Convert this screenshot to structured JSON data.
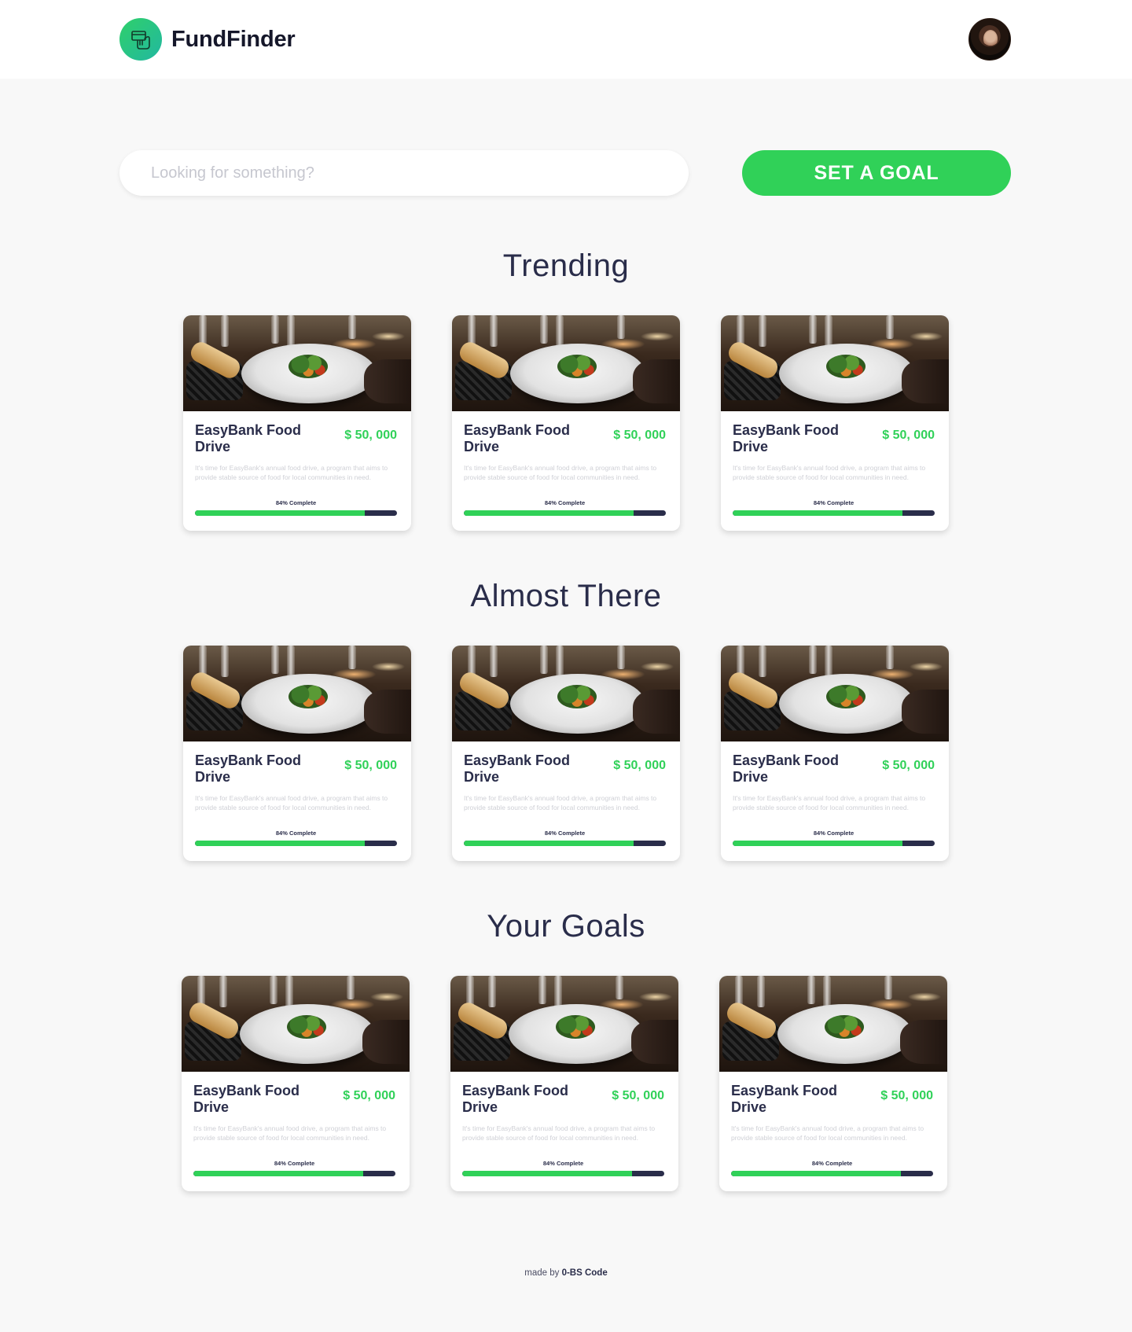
{
  "header": {
    "brand_name": "FundFinder",
    "logo_icon": "card-in-hand-icon",
    "colors": {
      "logo_gradient_start": "#2fd06a",
      "logo_gradient_end": "#22b8a0"
    }
  },
  "search": {
    "placeholder": "Looking for something?",
    "value": ""
  },
  "goal_button": {
    "label": "SET A GOAL",
    "color": "#30d158"
  },
  "sections": [
    {
      "title": "Trending",
      "cards": [
        {
          "title": "EasyBank Food Drive",
          "amount": "$ 50, 000",
          "description": "It's time for EasyBank's annual food drive, a program that aims to provide stable source of food for local communities in need.",
          "progress_label": "84% Complete",
          "progress": 0.84
        },
        {
          "title": "EasyBank Food Drive",
          "amount": "$ 50, 000",
          "description": "It's time for EasyBank's annual food drive, a program that aims to provide stable source of food for local communities in need.",
          "progress_label": "84% Complete",
          "progress": 0.84
        },
        {
          "title": "EasyBank Food Drive",
          "amount": "$ 50, 000",
          "description": "It's time for EasyBank's annual food drive, a program that aims to provide stable source of food for local communities in need.",
          "progress_label": "84% Complete",
          "progress": 0.84
        }
      ]
    },
    {
      "title": "Almost There",
      "cards": [
        {
          "title": "EasyBank Food Drive",
          "amount": "$ 50, 000",
          "description": "It's time for EasyBank's annual food drive, a program that aims to provide stable source of food for local communities in need.",
          "progress_label": "84% Complete",
          "progress": 0.84
        },
        {
          "title": "EasyBank Food Drive",
          "amount": "$ 50, 000",
          "description": "It's time for EasyBank's annual food drive, a program that aims to provide stable source of food for local communities in need.",
          "progress_label": "84% Complete",
          "progress": 0.84
        },
        {
          "title": "EasyBank Food Drive",
          "amount": "$ 50, 000",
          "description": "It's time for EasyBank's annual food drive, a program that aims to provide stable source of food for local communities in need.",
          "progress_label": "84% Complete",
          "progress": 0.84
        }
      ]
    },
    {
      "title": "Your Goals",
      "cards": [
        {
          "title": "EasyBank Food Drive",
          "amount": "$ 50, 000",
          "description": "It's time for EasyBank's annual food drive, a program that aims to provide stable source of food for local communities in need.",
          "progress_label": "84% Complete",
          "progress": 0.84
        },
        {
          "title": "EasyBank Food Drive",
          "amount": "$ 50, 000",
          "description": "It's time for EasyBank's annual food drive, a program that aims to provide stable source of food for local communities in need.",
          "progress_label": "84% Complete",
          "progress": 0.84
        },
        {
          "title": "EasyBank Food Drive",
          "amount": "$ 50, 000",
          "description": "It's time for EasyBank's annual food drive, a program that aims to provide stable source of food for local communities in need.",
          "progress_label": "84% Complete",
          "progress": 0.84
        }
      ]
    }
  ],
  "footer": {
    "prefix": "made by",
    "author": "0-BS Code"
  }
}
